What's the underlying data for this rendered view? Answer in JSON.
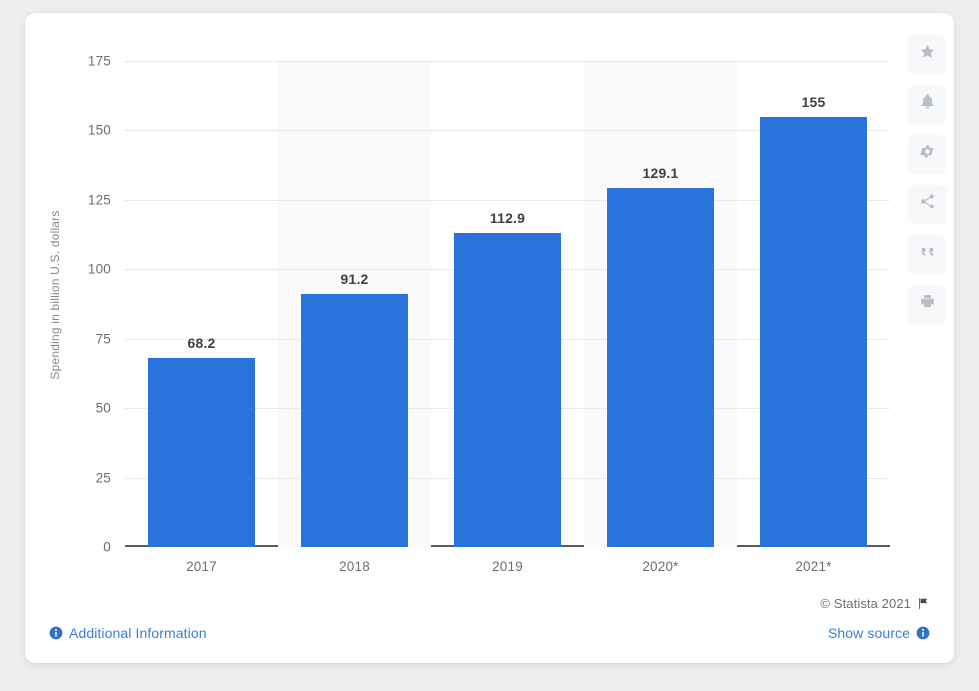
{
  "chart_data": {
    "type": "bar",
    "title": "",
    "subtitle": "",
    "xlabel": "",
    "ylabel": "Spending in billion U.S. dollars",
    "categories": [
      "2017",
      "2018",
      "2019",
      "2020*",
      "2021*"
    ],
    "values": [
      68.2,
      91.2,
      112.9,
      129.1,
      155
    ],
    "value_labels": [
      "68.2",
      "91.2",
      "112.9",
      "129.1",
      "155"
    ],
    "ylim": [
      0,
      175
    ],
    "yticks": [
      0,
      25,
      50,
      75,
      100,
      125,
      150,
      175
    ],
    "ytick_labels": [
      "0",
      "25",
      "50",
      "75",
      "100",
      "125",
      "150",
      "175"
    ],
    "grid": true,
    "legend": "none",
    "bar_color": "#2a73dd",
    "band_color": "#fafafa",
    "gridline_color": "#d6d6d6",
    "axis_color": "#5b5b5b"
  },
  "footer": {
    "copyright": "© Statista 2021",
    "flag_icon": "flag-icon",
    "additional_information": "Additional Information",
    "additional_information_icon": "info-icon",
    "show_source": "Show source",
    "show_source_icon": "info-icon",
    "link_color": "#3a7fd5"
  },
  "toolbar": {
    "buttons": [
      {
        "name": "favorite",
        "icon": "star-icon"
      },
      {
        "name": "notifications",
        "icon": "bell-icon"
      },
      {
        "name": "settings",
        "icon": "gear-icon"
      },
      {
        "name": "share",
        "icon": "share-icon"
      },
      {
        "name": "cite",
        "icon": "quote-icon"
      },
      {
        "name": "print",
        "icon": "printer-icon"
      }
    ]
  }
}
